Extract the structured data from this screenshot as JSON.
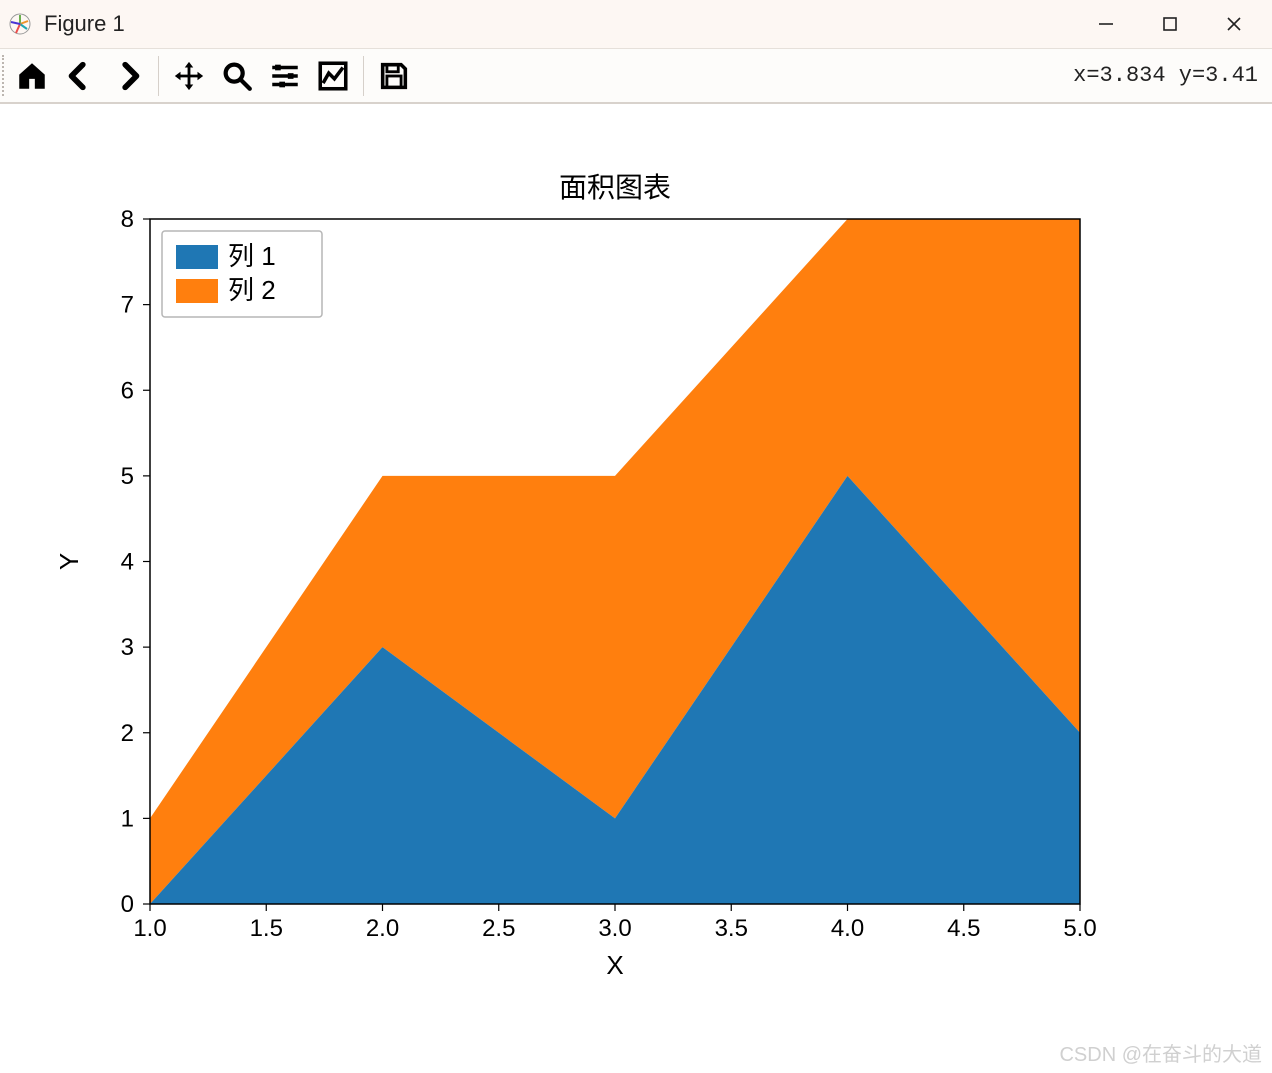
{
  "window": {
    "title": "Figure 1",
    "coord_readout": "x=3.834 y=3.41"
  },
  "toolbar": {
    "home": "Home",
    "back": "Back",
    "forward": "Forward",
    "pan": "Pan",
    "zoom": "Zoom",
    "subplots": "Configure subplots",
    "axes": "Edit axis",
    "save": "Save"
  },
  "watermark": "CSDN @在奋斗的大道",
  "chart_data": {
    "type": "area",
    "title": "面积图表",
    "xlabel": "X",
    "ylabel": "Y",
    "x": [
      1.0,
      2.0,
      3.0,
      4.0,
      5.0
    ],
    "series": [
      {
        "name": "列 1",
        "values": [
          0,
          3,
          1,
          5,
          2
        ],
        "color": "#1f77b4"
      },
      {
        "name": "列 2",
        "values": [
          1,
          2,
          4,
          3,
          6
        ],
        "color": "#ff7f0e"
      }
    ],
    "stacked_top": [
      1,
      5,
      5,
      8,
      8
    ],
    "xticks": [
      1.0,
      1.5,
      2.0,
      2.5,
      3.0,
      3.5,
      4.0,
      4.5,
      5.0
    ],
    "xticklabels": [
      "1.0",
      "1.5",
      "2.0",
      "2.5",
      "3.0",
      "3.5",
      "4.0",
      "4.5",
      "5.0"
    ],
    "yticks": [
      0,
      1,
      2,
      3,
      4,
      5,
      6,
      7,
      8
    ],
    "yticklabels": [
      "0",
      "1",
      "2",
      "3",
      "4",
      "5",
      "6",
      "7",
      "8"
    ],
    "xlim": [
      1.0,
      5.0
    ],
    "ylim": [
      0,
      8
    ]
  }
}
